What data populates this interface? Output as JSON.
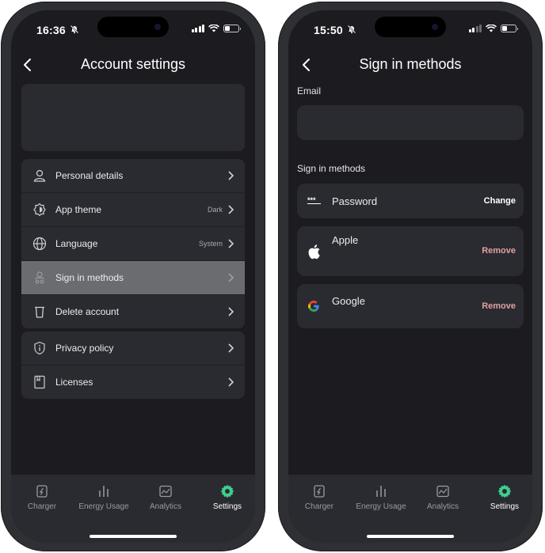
{
  "left_screen": {
    "status": {
      "time": "16:36"
    },
    "header": {
      "title": "Account settings"
    },
    "menu_group_1": [
      {
        "label": "Personal details",
        "value": ""
      },
      {
        "label": "App theme",
        "value": "Dark"
      },
      {
        "label": "Language",
        "value": "System"
      },
      {
        "label": "Sign in methods",
        "value": ""
      },
      {
        "label": "Delete account",
        "value": ""
      }
    ],
    "menu_group_2": [
      {
        "label": "Privacy policy"
      },
      {
        "label": "Licenses"
      }
    ]
  },
  "right_screen": {
    "status": {
      "time": "15:50"
    },
    "header": {
      "title": "Sign in methods"
    },
    "email_label": "Email",
    "email_value": "",
    "methods_label": "Sign in methods",
    "methods": [
      {
        "label": "Password",
        "action": "Change"
      },
      {
        "label": "Apple",
        "action": "Remove"
      },
      {
        "label": "Google",
        "action": "Remove"
      }
    ]
  },
  "tabbar": {
    "tabs": [
      {
        "label": "Charger"
      },
      {
        "label": "Energy Usage"
      },
      {
        "label": "Analytics"
      },
      {
        "label": "Settings"
      }
    ],
    "active_index": 3
  },
  "colors": {
    "background": "#1c1c20",
    "card": "#2a2b30",
    "active_row": "#6b6c70",
    "accent_green": "#3ecf8e",
    "remove_red": "#e0a19e"
  },
  "icons": {
    "rows": [
      "person-icon",
      "theme-icon",
      "globe-icon",
      "sign-in-icon",
      "trash-icon",
      "shield-info-icon",
      "license-icon"
    ],
    "tabs": [
      "charger-icon",
      "energy-bars-icon",
      "analytics-icon",
      "gear-icon"
    ],
    "methods": [
      "password-dots-icon",
      "apple-logo-icon",
      "google-logo-icon"
    ]
  }
}
